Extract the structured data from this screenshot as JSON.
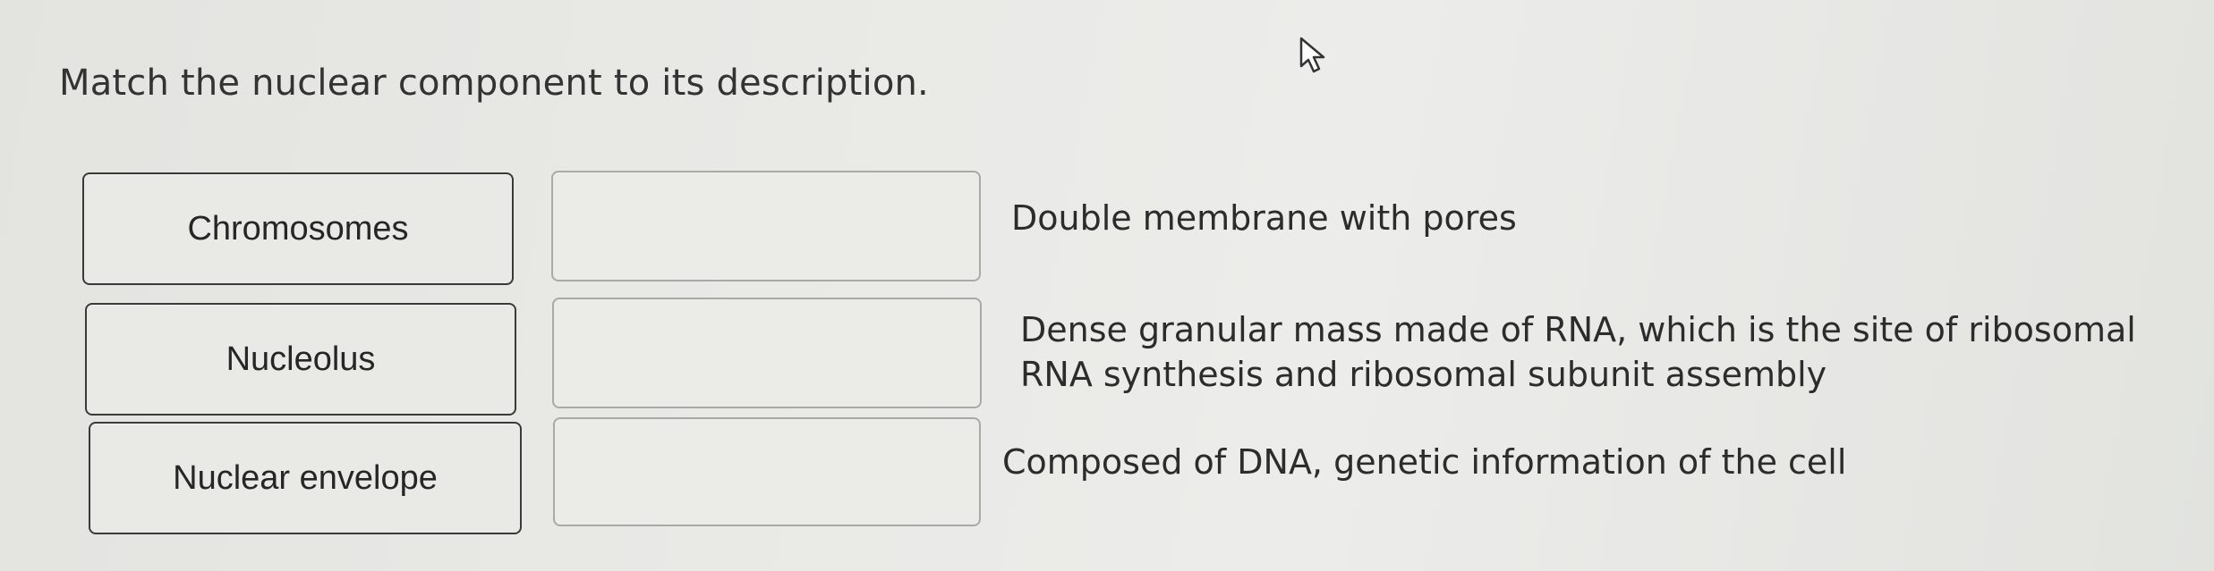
{
  "question": {
    "prompt": "Match the nuclear component to its description."
  },
  "terms": [
    {
      "label": "Chromosomes"
    },
    {
      "label": "Nucleolus"
    },
    {
      "label": "Nuclear envelope"
    }
  ],
  "descriptions": [
    {
      "text": "Double membrane with pores"
    },
    {
      "line1": "Dense granular mass made of RNA, which is the site of ribosomal",
      "line2": "RNA synthesis and ribosomal subunit assembly"
    },
    {
      "text": "Composed of DNA, genetic information of the cell"
    }
  ],
  "drop_targets": [
    {
      "value": ""
    },
    {
      "value": ""
    },
    {
      "value": ""
    }
  ],
  "icons": {
    "cursor": "mouse-pointer-icon"
  }
}
